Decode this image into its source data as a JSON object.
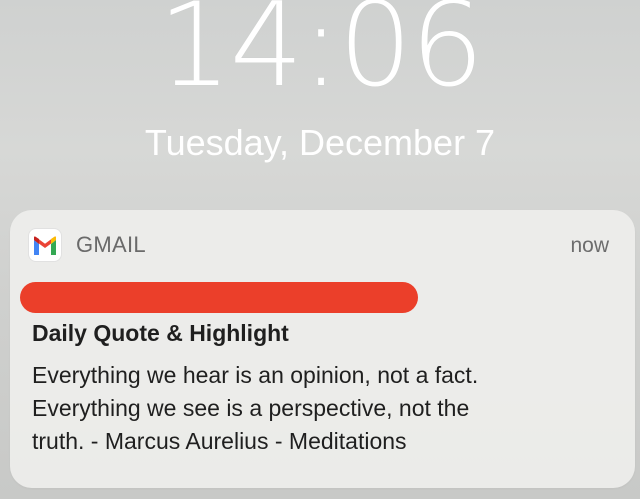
{
  "lockscreen": {
    "time": "14:06",
    "date": "Tuesday, December 7"
  },
  "notification": {
    "app_name": "GMAIL",
    "app_icon": "gmail-icon",
    "time_label": "now",
    "subject": "Daily Quote & Highlight",
    "body_lines": [
      "Everything we hear is an opinion, not a fact.",
      "Everything we see is a perspective, not the",
      "truth. - Marcus Aurelius - Meditations"
    ],
    "redaction_color": "#eb3f2a"
  }
}
